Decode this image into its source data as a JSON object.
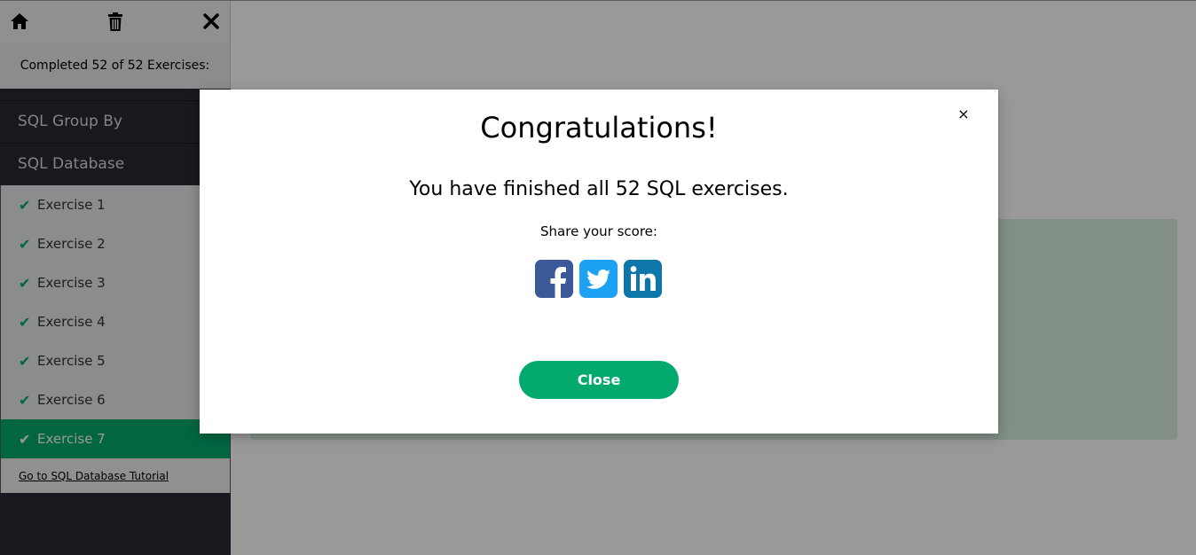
{
  "toolbar": {
    "home_icon": "home-icon",
    "trash_icon": "trash-icon",
    "close_icon": "close-icon"
  },
  "progress": {
    "text": "Completed 52 of 52 Exercises:"
  },
  "categories": [
    {
      "label": "SQL Group By"
    },
    {
      "label": "SQL Database"
    }
  ],
  "exercises": [
    {
      "label": "Exercise 1",
      "done": true
    },
    {
      "label": "Exercise 2",
      "done": true
    },
    {
      "label": "Exercise 3",
      "done": true
    },
    {
      "label": "Exercise 4",
      "done": true
    },
    {
      "label": "Exercise 5",
      "done": true
    },
    {
      "label": "Exercise 6",
      "done": true
    },
    {
      "label": "Exercise 7",
      "done": true,
      "active": true
    }
  ],
  "tutorial_link": "Go to SQL Database Tutorial",
  "modal": {
    "close_glyph": "×",
    "title": "Congratulations!",
    "message": "You have finished all 52 SQL exercises.",
    "share_label": "Share your score:",
    "social": [
      "facebook-icon",
      "twitter-icon",
      "linkedin-icon"
    ],
    "button_label": "Close"
  },
  "colors": {
    "accent": "#04aa6d",
    "sidebar_dark": "#282a35",
    "facebook": "#3b5998",
    "twitter": "#1da1f2",
    "linkedin": "#0e76a8"
  }
}
